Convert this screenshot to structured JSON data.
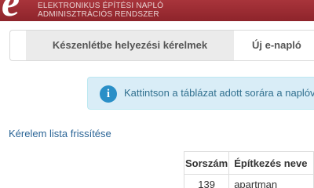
{
  "header": {
    "logo_letter": "e",
    "line1": "ELEKTRONIKUS ÉPÍTÉSI NAPLÓ",
    "line2": "ADMINISZTRÁCIÓS RENDSZER",
    "brand_color": "#9b2c33"
  },
  "tabs": [
    {
      "label": "Készenlétbe helyezési kérelmek",
      "active": true
    },
    {
      "label": "Új e-napló",
      "active": false
    }
  ],
  "alert": {
    "icon": "info-icon",
    "icon_glyph": "i",
    "text": "Kattintson a táblázat adott sorára a naplóval kapcsolatos kérelem megtekintéséhez."
  },
  "refresh_link": "Kérelem lista frissítése",
  "table": {
    "columns": [
      "Sorszám",
      "Építkezés neve"
    ],
    "rows": [
      [
        "139",
        "apartman"
      ]
    ]
  }
}
